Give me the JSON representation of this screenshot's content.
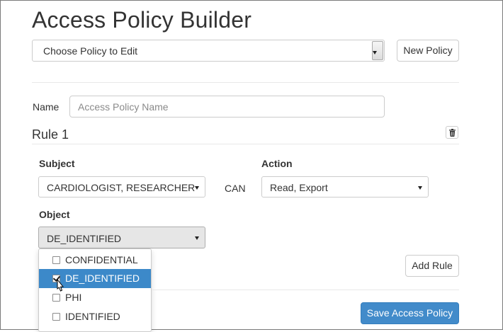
{
  "page": {
    "title": "Access Policy Builder"
  },
  "policy_select": {
    "value": "Choose Policy to Edit"
  },
  "toolbar": {
    "new_policy_label": "New Policy"
  },
  "name_field": {
    "label": "Name",
    "placeholder": "Access Policy Name",
    "value": ""
  },
  "rule": {
    "title": "Rule 1",
    "delete_icon": "trash-icon",
    "subject": {
      "label": "Subject",
      "value": "CARDIOLOGIST, RESEARCHER"
    },
    "connector": "CAN",
    "action": {
      "label": "Action",
      "value": "Read, Export"
    },
    "object": {
      "label": "Object",
      "value": "DE_IDENTIFIED",
      "options": [
        {
          "label": "CONFIDENTIAL",
          "checked": false,
          "highlighted": false
        },
        {
          "label": "DE_IDENTIFIED",
          "checked": true,
          "highlighted": true
        },
        {
          "label": "PHI",
          "checked": false,
          "highlighted": false
        },
        {
          "label": "IDENTIFIED",
          "checked": false,
          "highlighted": false
        }
      ]
    }
  },
  "actions": {
    "add_rule_label": "Add Rule",
    "save_label": "Save Access Policy"
  },
  "colors": {
    "primary": "#428bca",
    "highlight": "#3c89c9",
    "border": "#cccccc"
  }
}
